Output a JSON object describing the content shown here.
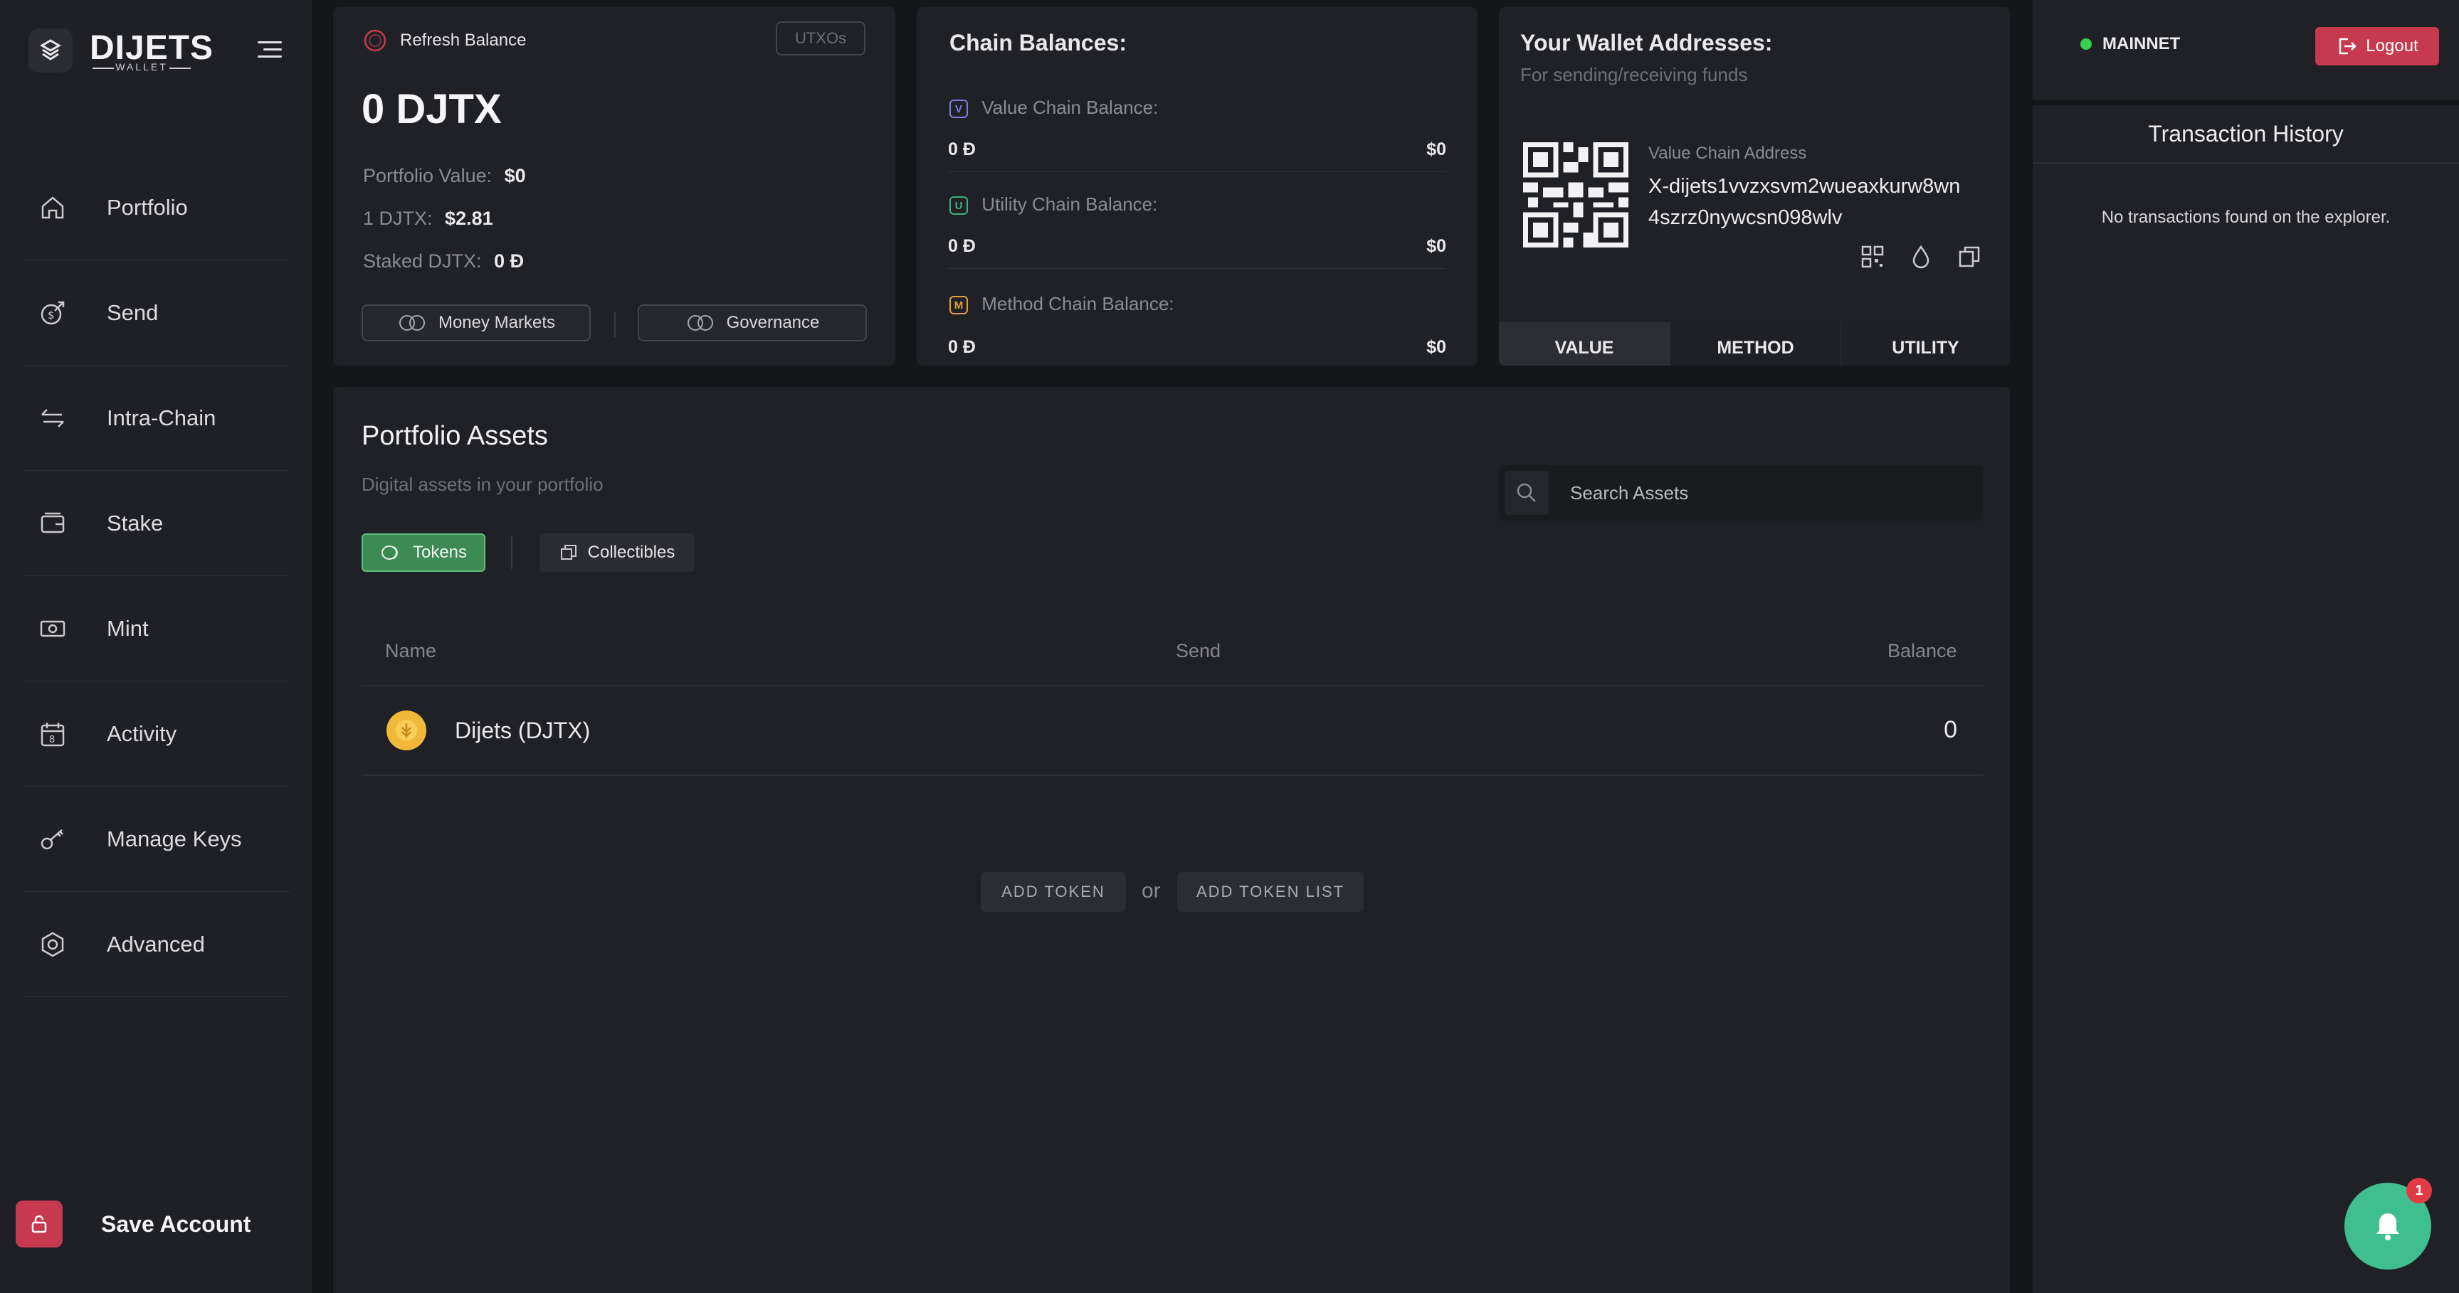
{
  "brand": {
    "name": "DIJETS",
    "sub": "WALLET"
  },
  "sidebar": {
    "items": [
      {
        "label": "Portfolio",
        "icon": "home-icon"
      },
      {
        "label": "Send",
        "icon": "send-coin-icon"
      },
      {
        "label": "Intra-Chain",
        "icon": "transfer-arrows-icon"
      },
      {
        "label": "Stake",
        "icon": "stake-wallet-icon"
      },
      {
        "label": "Mint",
        "icon": "banknote-icon"
      },
      {
        "label": "Activity",
        "icon": "calendar-icon"
      },
      {
        "label": "Manage Keys",
        "icon": "key-icon"
      },
      {
        "label": "Advanced",
        "icon": "hexagon-settings-icon"
      }
    ],
    "save_account": "Save Account"
  },
  "balance": {
    "refresh_label": "Refresh Balance",
    "utxos_label": "UTXOs",
    "total": "0 DJTX",
    "portfolio_value_label": "Portfolio Value:",
    "portfolio_value": "$0",
    "price_label": "1 DJTX:",
    "price": "$2.81",
    "staked_label": "Staked DJTX:",
    "staked": "0 Đ",
    "money_markets": "Money Markets",
    "governance": "Governance"
  },
  "chains": {
    "title": "Chain Balances:",
    "rows": [
      {
        "badge": "V",
        "label": "Value Chain Balance:",
        "amount": "0 Đ",
        "usd": "$0",
        "color": "#7a7fe0"
      },
      {
        "badge": "U",
        "label": "Utility Chain Balance:",
        "amount": "0 Đ",
        "usd": "$0",
        "color": "#3fb27a"
      },
      {
        "badge": "M",
        "label": "Method Chain Balance:",
        "amount": "0 Đ",
        "usd": "$0",
        "color": "#e0a13a"
      }
    ]
  },
  "wallet": {
    "title": "Your Wallet Addresses:",
    "subtitle": "For sending/receiving funds",
    "address_label": "Value Chain Address",
    "address_line1": "X-dijets1vvzxsvm2wueaxkurw8wn",
    "address_line2": "4szrz0nywcsn098wlv",
    "tabs": [
      "VALUE",
      "METHOD",
      "UTILITY"
    ],
    "active_tab": "VALUE"
  },
  "assets": {
    "title": "Portfolio Assets",
    "subtitle": "Digital assets in your portfolio",
    "search_placeholder": "Search Assets",
    "tabs": [
      "Tokens",
      "Collectibles"
    ],
    "columns": [
      "Name",
      "Send",
      "Balance"
    ],
    "rows": [
      {
        "name": "Dijets (DJTX)",
        "balance": "0"
      }
    ],
    "add_token": "ADD TOKEN",
    "or": "or",
    "add_token_list": "ADD TOKEN LIST"
  },
  "header": {
    "network": "MAINNET",
    "network_color": "#3ccf4e",
    "logout": "Logout"
  },
  "history": {
    "title": "Transaction History",
    "empty": "No transactions found on the explorer."
  },
  "notifications": {
    "count": "1"
  },
  "colors": {
    "accent_red": "#c7394e",
    "accent_green": "#3fbf8f",
    "tokens_green": "#3d8a55"
  }
}
